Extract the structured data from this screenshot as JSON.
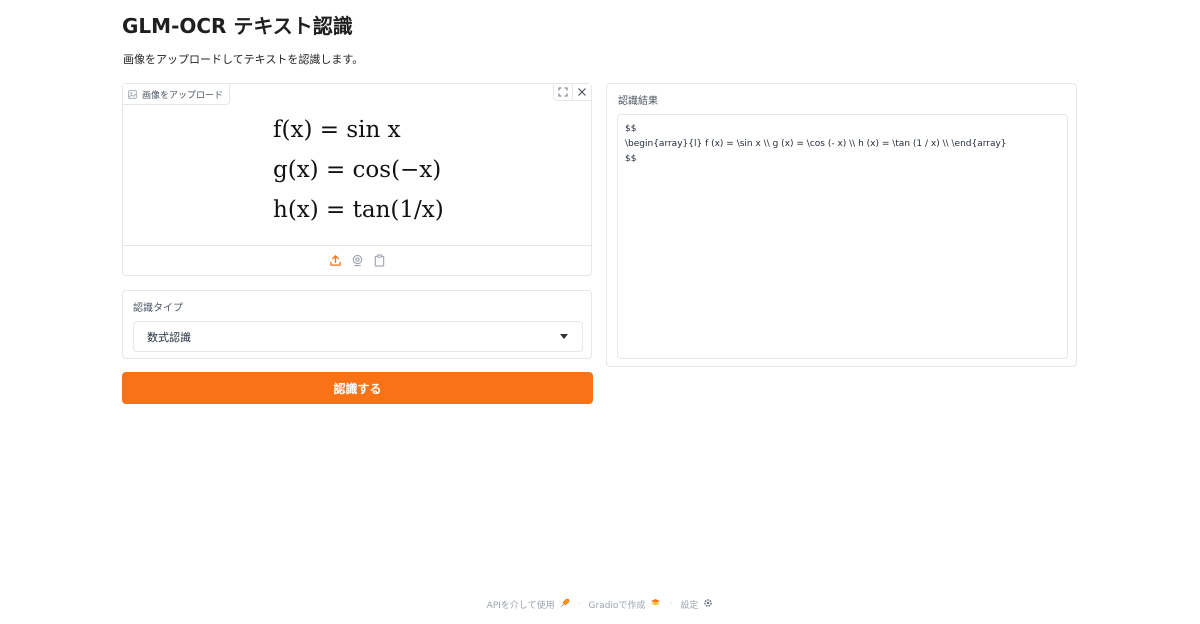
{
  "header": {
    "title": "GLM-OCR テキスト認識",
    "description": "画像をアップロードしてテキストを認識します。"
  },
  "image_upload": {
    "label": "画像をアップロード",
    "formula_lines": [
      "f(x) = sin x",
      "g(x) = cos(−x)",
      "h(x) = tan(1/x)"
    ]
  },
  "recognition_type": {
    "label": "認識タイプ",
    "selected": "数式認識"
  },
  "submit": {
    "label": "認識する"
  },
  "result": {
    "label": "認識結果",
    "lines": [
      "$$",
      "\\begin{array}{l} f (x) = \\sin x \\\\ g (x) = \\cos (- x) \\\\ h (x) = \\tan (1 / x) \\\\ \\end{array}",
      "$$"
    ]
  },
  "footer": {
    "api_label": "APIを介して使用",
    "gradio_label": "Gradioで作成",
    "settings_label": "設定",
    "separator": "·"
  },
  "colors": {
    "accent": "#f97316",
    "border": "#e5e7eb"
  }
}
